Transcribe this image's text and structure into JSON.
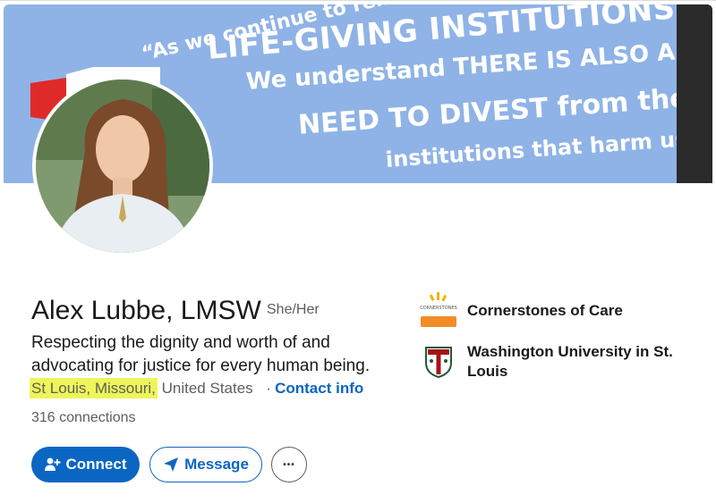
{
  "banner": {
    "quote_lines": [
      "“As we continue to reinvest in",
      "LIFE-GIVING INSTITUTIONS,",
      "We understand THERE IS ALSO A",
      "NEED TO DIVEST from the",
      "institutions that harm us.”"
    ],
    "background_color": "#8fb3e6"
  },
  "profile": {
    "name": "Alex Lubbe, LMSW",
    "pronouns": "She/Her",
    "headline": "Respecting the dignity and worth of and advocating for justice for every human being.",
    "location_highlighted": "St Louis, Missouri,",
    "location_rest": "United States",
    "separator": "·",
    "contact_info": "Contact info",
    "connections": "316 connections"
  },
  "actions": {
    "connect_label": "Connect",
    "message_label": "Message",
    "more_label": "•••"
  },
  "organizations": [
    {
      "name": "Cornerstones of Care",
      "logo_text": "CORNERSTONES",
      "icon": "cornerstones-logo"
    },
    {
      "name": "Washington University in St. Louis",
      "icon": "washu-shield-logo"
    }
  ],
  "colors": {
    "accent": "#0a66c2",
    "highlight": "#eef55a",
    "text_secondary": "#5e5e5e"
  }
}
